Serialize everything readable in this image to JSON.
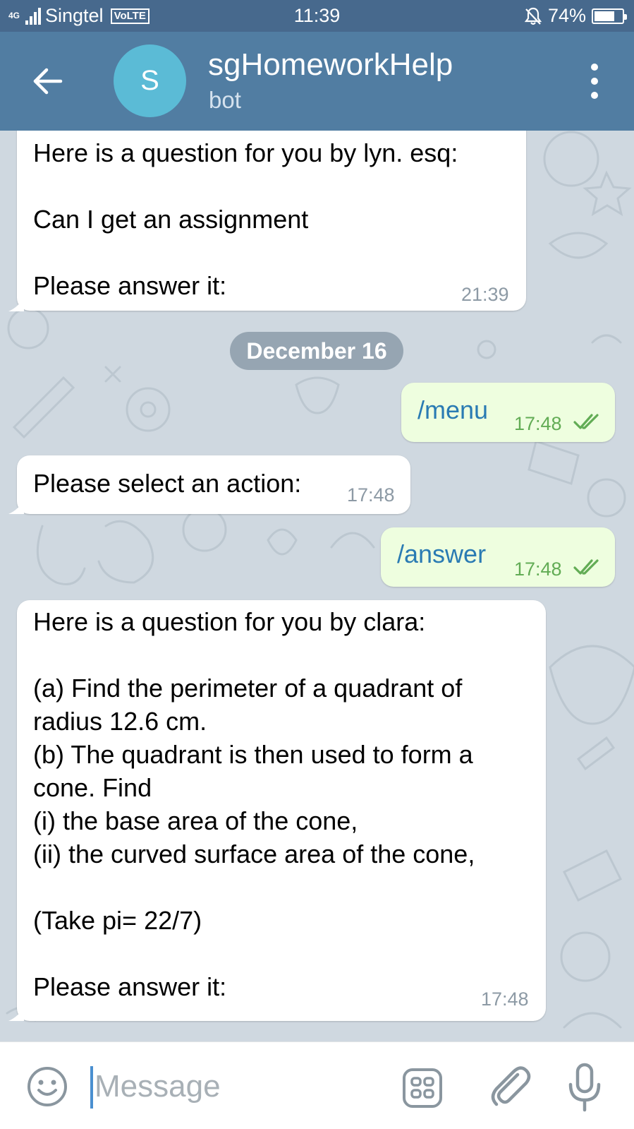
{
  "status_bar": {
    "network": "4G",
    "carrier": "Singtel",
    "volte": "VoLTE",
    "time": "11:39",
    "battery_percent": "74%",
    "battery_level": 0.74
  },
  "header": {
    "avatar_letter": "S",
    "title": "sgHomeworkHelp",
    "subtitle": "bot",
    "icons": {
      "back": "arrow-left-icon",
      "menu": "more-vertical-icon"
    }
  },
  "messages": {
    "m1": {
      "text": "Here is a question for you by lyn. esq:\n\nCan I get an assignment\n\nPlease answer it:",
      "time": "21:39"
    },
    "date_separator": "December 16",
    "m2": {
      "text": "/menu",
      "time": "17:48"
    },
    "m3": {
      "text": "Please select an action:",
      "time": "17:48"
    },
    "m4": {
      "text": "/answer",
      "time": "17:48"
    },
    "m5": {
      "text": "Here is a question for you by clara:\n\n(a) Find the perimeter of a quadrant of\nradius 12.6 cm.\n(b) The quadrant is then used to form a\ncone. Find\n(i) the base area of the cone,\n(ii) the curved surface area of the cone,\n\n(Take pi= 22/7)\n\nPlease answer it:",
      "time": "17:48"
    }
  },
  "input_bar": {
    "placeholder": "Message",
    "icons": {
      "emoji": "smiley-icon",
      "bot_keyboard": "bot-keyboard-icon",
      "attach": "paperclip-icon",
      "mic": "microphone-icon"
    }
  },
  "colors": {
    "status_bar": "#47698d",
    "header": "#517da2",
    "chat_background": "#cfd8e0",
    "outgoing_bubble": "#eefedf",
    "incoming_bubble": "#ffffff",
    "read_check": "#62ac55"
  }
}
